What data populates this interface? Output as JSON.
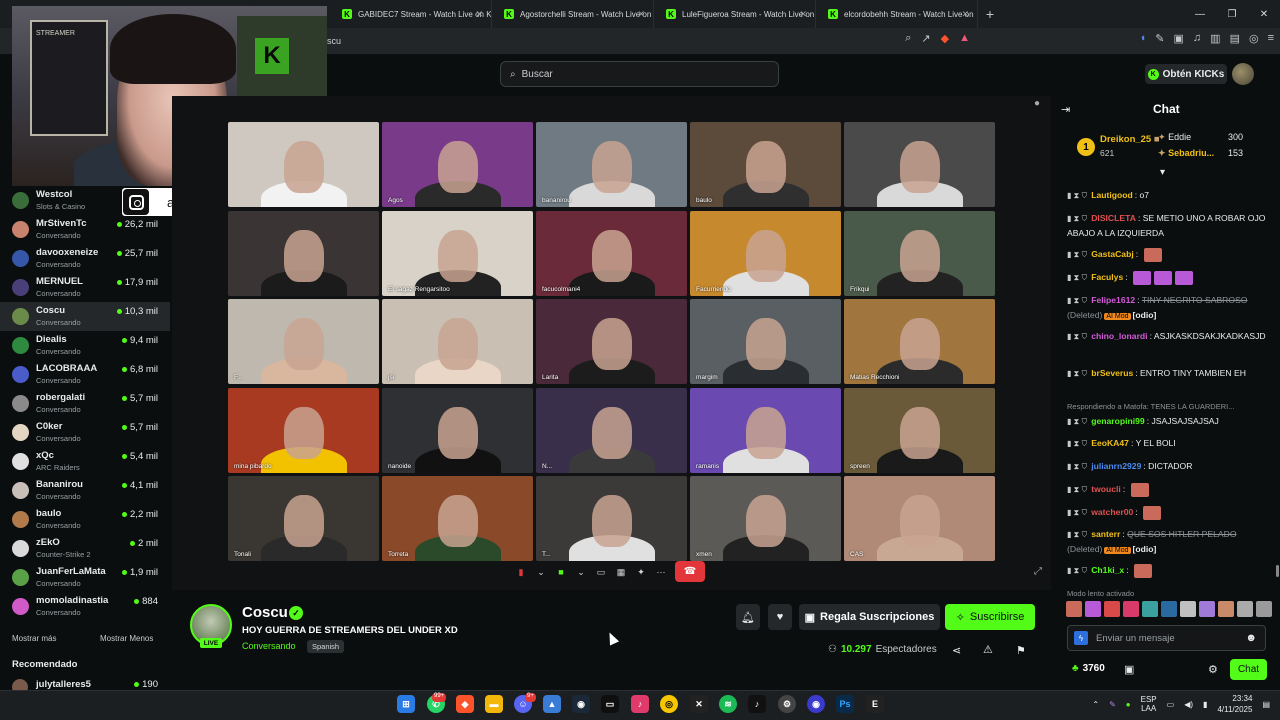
{
  "browser": {
    "tabs": [
      {
        "label": "GABIDEC7 Stream - Watch Live on Ki"
      },
      {
        "label": "Agostorchelli Stream - Watch Live on"
      },
      {
        "label": "LuleFigueroa Stream - Watch Live on"
      },
      {
        "label": "elcordobehh Stream - Watch Live on"
      }
    ],
    "url": "oscu"
  },
  "header": {
    "search_placeholder": "Buscar",
    "get_kicks_label": "Obtén KICKs"
  },
  "overlay": {
    "instagram_handle": "adruuuh",
    "webcam_text": "STREAMER"
  },
  "sidebar": {
    "channels": [
      {
        "name": "Westcol",
        "category": "Slots & Casino",
        "viewers": "",
        "av_color": "#3a6d3a"
      },
      {
        "name": "MrStivenTc",
        "category": "Conversando",
        "viewers": "26,2 mil",
        "av_color": "#c9826d"
      },
      {
        "name": "davooxeneize",
        "category": "Conversando",
        "viewers": "25,7 mil",
        "av_color": "#3657a8"
      },
      {
        "name": "MERNUEL",
        "category": "Conversando",
        "viewers": "17,9 mil",
        "av_color": "#4b3f7a"
      },
      {
        "name": "Coscu",
        "category": "Conversando",
        "viewers": "10,3 mil",
        "av_color": "#6b8b4b"
      },
      {
        "name": "Diealis",
        "category": "Conversando",
        "viewers": "9,4 mil",
        "av_color": "#2d8a3f"
      },
      {
        "name": "LACOBRAAA",
        "category": "Conversando",
        "viewers": "6,8 mil",
        "av_color": "#4a5cc9"
      },
      {
        "name": "robergalati",
        "category": "Conversando",
        "viewers": "5,7 mil",
        "av_color": "#8a8a8a"
      },
      {
        "name": "C0ker",
        "category": "Conversando",
        "viewers": "5,7 mil",
        "av_color": "#e2d6c2"
      },
      {
        "name": "xQc",
        "category": "ARC Raiders",
        "viewers": "5,4 mil",
        "av_color": "#e0e0e0"
      },
      {
        "name": "Bananirou",
        "category": "Conversando",
        "viewers": "4,1 mil",
        "av_color": "#c8c0b8"
      },
      {
        "name": "baulo",
        "category": "Conversando",
        "viewers": "2,2 mil",
        "av_color": "#b07a4a"
      },
      {
        "name": "zEkO",
        "category": "Counter-Strike 2",
        "viewers": "2 mil",
        "av_color": "#d9d9d9"
      },
      {
        "name": "JuanFerLaMata",
        "category": "Conversando",
        "viewers": "1,9 mil",
        "av_color": "#5aa046"
      },
      {
        "name": "momoladinastia",
        "category": "Conversando",
        "viewers": "884",
        "av_color": "#d05ac8"
      }
    ],
    "show_more": "Mostrar más",
    "show_less": "Mostrar Menos",
    "recommended_title": "Recomendado",
    "recommended": {
      "name": "julytalleres5",
      "viewers": "190"
    }
  },
  "video": {
    "participants": [
      {
        "name": "",
        "bg": "#cfc8c0",
        "body": "#f2f2f2"
      },
      {
        "name": "Agos",
        "bg": "#7a3a8a",
        "body": "#2a2a2a"
      },
      {
        "name": "bananirou",
        "bg": "#6f7a82",
        "body": "#d9d9d9"
      },
      {
        "name": "baulo",
        "bg": "#5c4a3a",
        "body": "#2f2f2f"
      },
      {
        "name": "",
        "bg": "#4a4a4a",
        "body": "#d9d9d9"
      },
      {
        "name": "",
        "bg": "#3a3434",
        "body": "#1b1b1b"
      },
      {
        "name": "El sagaz Rengarsitoo",
        "bg": "#d8d2c8",
        "body": "#222"
      },
      {
        "name": "facucolmani4",
        "bg": "#6a2a3a",
        "body": "#1a1a1a"
      },
      {
        "name": "Facurriendo",
        "bg": "#c7892e",
        "body": "#e0e0e0"
      },
      {
        "name": "Frikqui",
        "bg": "#4a5a4a",
        "body": "#222"
      },
      {
        "name": "F...",
        "bg": "#bfb8ae",
        "body": "#d9b79e"
      },
      {
        "name": "jsi",
        "bg": "#c9bfb2",
        "body": "#e9d6c6"
      },
      {
        "name": "Larita",
        "bg": "#4a2a3a",
        "body": "#1c1c1c"
      },
      {
        "name": "margim",
        "bg": "#5a5f63",
        "body": "#2a2e33"
      },
      {
        "name": "Matias Recchioni",
        "bg": "#a0763e",
        "body": "#2b2b2b"
      },
      {
        "name": "mina pibardo",
        "bg": "#a83a22",
        "body": "#f2c200"
      },
      {
        "name": "nanoide",
        "bg": "#2f3034",
        "body": "#111"
      },
      {
        "name": "N...",
        "bg": "#3a2f4a",
        "body": "#3a3a3a"
      },
      {
        "name": "ramanis",
        "bg": "#6a4ab0",
        "body": "#e0e0e0"
      },
      {
        "name": "spreen",
        "bg": "#6a5a3a",
        "body": "#1a1a1a"
      },
      {
        "name": "Tonali",
        "bg": "#3a3632",
        "body": "#2a2a2a"
      },
      {
        "name": "Torreta",
        "bg": "#8a4a2a",
        "body": "#2a4a2a"
      },
      {
        "name": "T...",
        "bg": "#3c3a38",
        "body": "#e0e0e0"
      },
      {
        "name": "xmen",
        "bg": "#5c5a56",
        "body": "#222"
      },
      {
        "name": "CAS",
        "bg": "#b08a76",
        "body": "#c9a893"
      }
    ]
  },
  "stream": {
    "streamer": "Coscu",
    "live_badge": "LIVE",
    "title": "HOY GUERRA DE STREAMERS DEL UNDER XD",
    "category": "Conversando",
    "language": "Spanish",
    "gift_subs_label": "Regala Suscripciones",
    "subscribe_label": "Suscribirse",
    "viewers_count": "10.297",
    "viewers_label": "Espectadores"
  },
  "chat": {
    "title": "Chat",
    "leaderboard": {
      "top": {
        "rank": "1",
        "name": "Dreikon_25",
        "points": "621"
      },
      "others": [
        {
          "name": "Eddie",
          "points": "300"
        },
        {
          "name": "Sebadriu...",
          "points": "153"
        }
      ]
    },
    "messages": [
      {
        "user": "Lautigood",
        "color": "#f0c017",
        "text": "o7"
      },
      {
        "user": "DISICLETA",
        "color": "#e05050",
        "text": "SE METIO UNO A ROBAR OJO ABAJO A LA IZQUIERDA"
      },
      {
        "user": "GastaCabj",
        "color": "#f0c017",
        "text": ""
      },
      {
        "user": "Faculys",
        "color": "#f0c017",
        "text": ""
      },
      {
        "user": "Felipe1612",
        "color": "#d35ad8",
        "text": "TINY NEGRITO SABROSO",
        "deleted": "(Deleted)",
        "mod": "AI Mod",
        "tag": "[odio]"
      },
      {
        "user": "chino_lonardi",
        "color": "#d35ad8",
        "text": "ASJKASKDSAKJKADKASJD"
      },
      {
        "user": "brSeverus",
        "color": "#f0c017",
        "text": "ENTRO TINY TAMBIEN EH"
      },
      {
        "user": "genaropini99",
        "color": "#53fc18",
        "text": "JSAJSAJSAJSAJ"
      },
      {
        "user": "EeoKA47",
        "color": "#f0c017",
        "text": "Y EL BOLI"
      },
      {
        "user": "julianrn2929",
        "color": "#4a8af0",
        "text": "DICTADOR"
      },
      {
        "user": "twoucli",
        "color": "#e05050",
        "text": ""
      },
      {
        "user": "watcher00",
        "color": "#e05050",
        "text": ""
      },
      {
        "user": "santerr",
        "color": "#f0c017",
        "text": "QUE SOS HITLER PELADO",
        "deleted": "(Deleted)",
        "mod": "AI Mod",
        "tag": "[odio]"
      },
      {
        "user": "Ch1ki_x",
        "color": "#53fc18",
        "text": ""
      }
    ],
    "reply_hint": "Respondiendo a Matofa: TENES LA GUARDERI...",
    "slow_mode": "Modo lento activado",
    "input_placeholder": "Enviar un mensaje",
    "points": "3760",
    "send_label": "Chat"
  },
  "taskbar": {
    "whatsapp_badge": "99+",
    "discord_badge": "9+",
    "lang_top": "ESP",
    "lang_bottom": "LAA",
    "time": "23:34",
    "date": "4/11/2025"
  },
  "colors": {
    "accent": "#53fc18",
    "background": "#0b0e0f",
    "surface": "#24282a"
  }
}
